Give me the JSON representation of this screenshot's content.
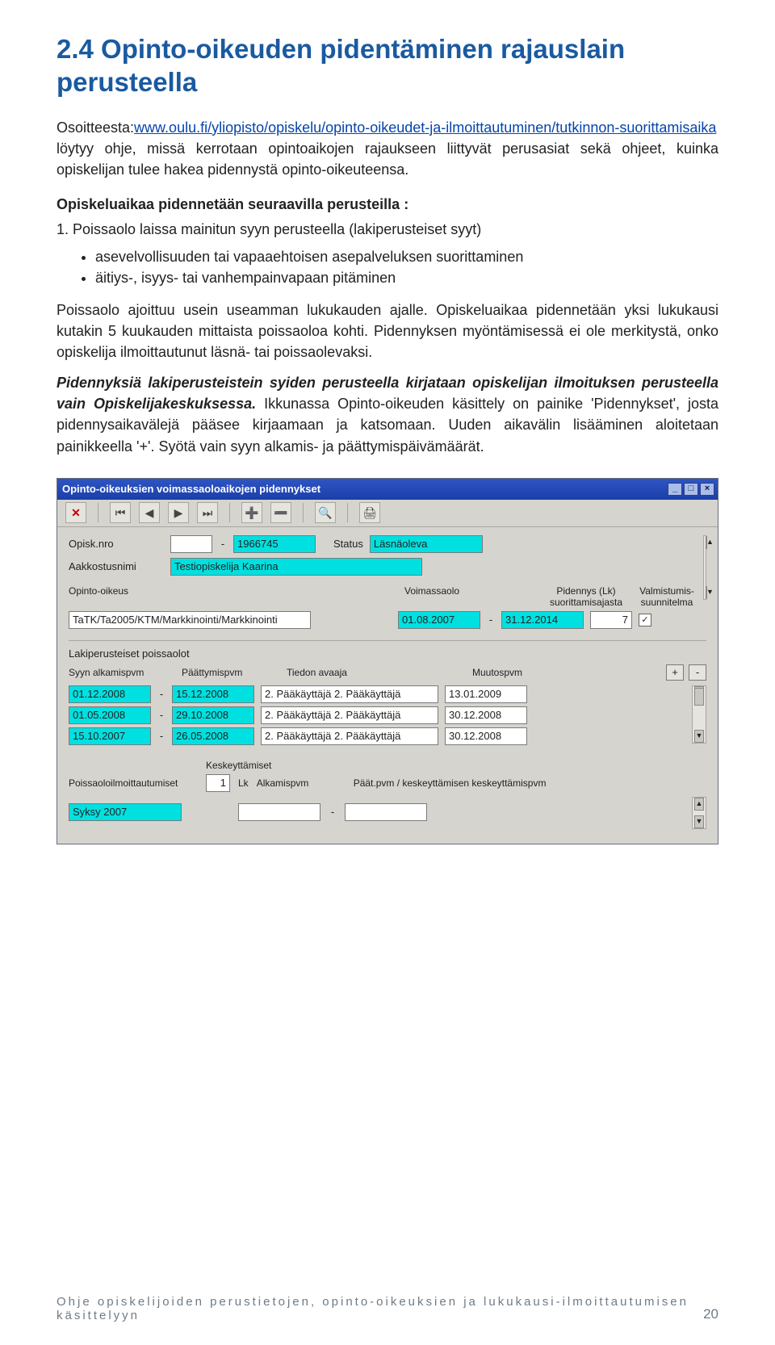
{
  "heading": "2.4 Opinto-oikeuden pidentäminen rajauslain perusteella",
  "intro_prefix": "Osoitteesta:",
  "intro_link": "www.oulu.fi/yliopisto/opiskelu/opinto-oikeudet-ja-ilmoittautuminen/tutkinnon-suorittamisaika",
  "intro_rest": " löytyy ohje, missä kerrotaan opintoaikojen rajaukseen liittyvät perusasiat sekä ohjeet, kuinka opiskelijan tulee hakea pidennystä opinto-oikeuteensa.",
  "subhead": "Opiskeluaikaa pidennetään seuraavilla perusteilla :",
  "numline": "1. Poissaolo laissa mainitun syyn perusteella (lakiperusteiset syyt)",
  "bullets": [
    "asevelvollisuuden tai vapaaehtoisen asepalveluksen suorittaminen",
    "äitiys-, isyys- tai vanhempainvapaan pitäminen"
  ],
  "para1": "Poissaolo ajoittuu usein useamman lukukauden ajalle. Opiskeluaikaa pidennetään yksi lukukausi kutakin 5 kuukauden mittaista poissaoloa kohti. Pidennyksen myöntämisessä ei ole merkitystä, onko opiskelija ilmoittautunut läsnä- tai poissaolevaksi.",
  "para2_bold": "Pidennyksiä lakiperusteistein syiden perusteella kirjataan opiskelijan ilmoituksen perusteella vain Opiskelijakeskuksessa.",
  "para2_rest": " Ikkunassa Opinto-oikeuden käsittely on painike 'Pidennykset', josta pidennysaikavälejä pääsee kirjaamaan ja katsomaan. Uuden aikavälin lisääminen aloitetaan painikkeella '+'. Syötä vain syyn alkamis- ja päättymispäivämäärät.",
  "app": {
    "title": "Opinto-oikeuksien voimassaoloaikojen pidennykset",
    "labels": {
      "opisknro": "Opisk.nro",
      "aakkostus": "Aakkostusnimi",
      "status": "Status",
      "opintooikeus": "Opinto-oikeus",
      "voimassaolo": "Voimassaolo",
      "pidennys": "Pidennys (Lk) suorittamisajasta",
      "valmistumis": "Valmistumis-suunnitelma",
      "laki": "Lakiperusteiset poissaolot",
      "syyn": "Syyn alkamispvm",
      "paattymis": "Päättymispvm",
      "tiedon": "Tiedon avaaja",
      "muutos": "Muutospvm",
      "keskeyt": "Keskeyttämiset",
      "alkamis": "Alkamispvm",
      "paatpvm": "Päät.pvm / keskeyttämisen keskeyttämispvm",
      "poissa": "Poissaoloilmoittautumiset",
      "lk": "Lk"
    },
    "values": {
      "opisknro": "1966745",
      "statusval": "Läsnäoleva",
      "name": "Testiopiskelija Kaarina",
      "oo": "TaTK/Ta2005/KTM/Markkinointi/Markkinointi",
      "voim1": "01.08.2007",
      "voim2": "31.12.2014",
      "pidval": "7",
      "chk": "✓",
      "poissacount": "1",
      "term": "Syksy 2007"
    },
    "rows": [
      {
        "a": "01.12.2008",
        "b": "15.12.2008",
        "c": "2. Pääkäyttäjä 2. Pääkäyttäjä",
        "d": "13.01.2009"
      },
      {
        "a": "01.05.2008",
        "b": "29.10.2008",
        "c": "2. Pääkäyttäjä 2. Pääkäyttäjä",
        "d": "30.12.2008"
      },
      {
        "a": "15.10.2007",
        "b": "26.05.2008",
        "c": "2. Pääkäyttäjä 2. Pääkäyttäjä",
        "d": "30.12.2008"
      }
    ]
  },
  "footer": {
    "text": "Ohje opiskelijoiden perustietojen, opinto-oikeuksien ja lukukausi-ilmoittautumisen käsittelyyn",
    "page": "20"
  }
}
